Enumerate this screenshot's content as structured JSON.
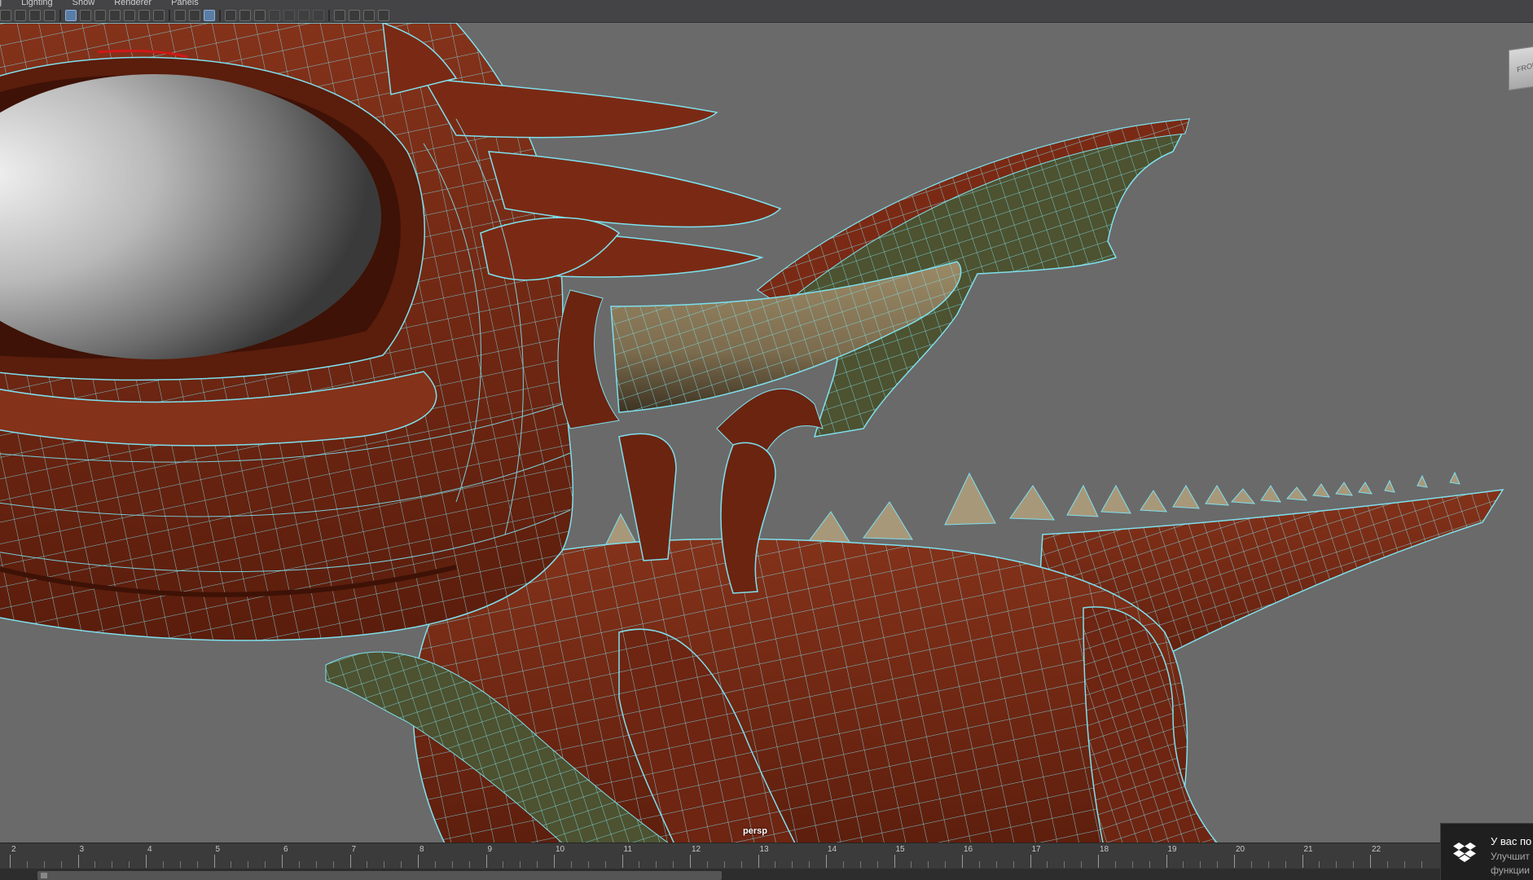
{
  "menu": {
    "items": [
      "g",
      "Lighting",
      "Show",
      "Renderer",
      "Panels"
    ]
  },
  "toolbar": {
    "icons": [
      "select-camera-icon",
      "camera-attributes-icon",
      "snapshot-icon",
      "pen-icon",
      "grid-icon",
      "film-gate-icon",
      "resolution-gate-icon",
      "gate-mask-icon",
      "field-chart-icon",
      "safe-action-icon",
      "safe-title-icon",
      "wireframe-icon",
      "smooth-shade-icon",
      "wireframe-on-shaded-icon",
      "textured-icon",
      "use-all-lights-icon",
      "shadows-icon",
      "ambient-occlusion-icon",
      "motion-blur-icon",
      "anti-aliasing-icon",
      "depth-of-field-icon",
      "isolate-select-icon",
      "xray-icon",
      "xray-joints-icon",
      "xray-components-icon"
    ]
  },
  "viewport": {
    "camera_label": "persp",
    "viewcube_label": "FRONT",
    "colors": {
      "background": "#6a6a6a",
      "body": "#7a2a14",
      "body_dark": "#4e180a",
      "wireframe": "#7fe0ee",
      "wing_membrane": "#4d5230",
      "horn": "#8a7858",
      "spike": "#a8987a",
      "eye": "#d8d8d8"
    }
  },
  "timeslider": {
    "ticks": [
      "2",
      "3",
      "4",
      "5",
      "6",
      "7",
      "8",
      "9",
      "10",
      "11",
      "12",
      "13",
      "14",
      "15",
      "16",
      "17",
      "18",
      "19",
      "20",
      "21",
      "22"
    ]
  },
  "notification": {
    "title": "У вас по",
    "line1": "Улучшит",
    "line2": "функции",
    "icon": "dropbox-icon"
  }
}
